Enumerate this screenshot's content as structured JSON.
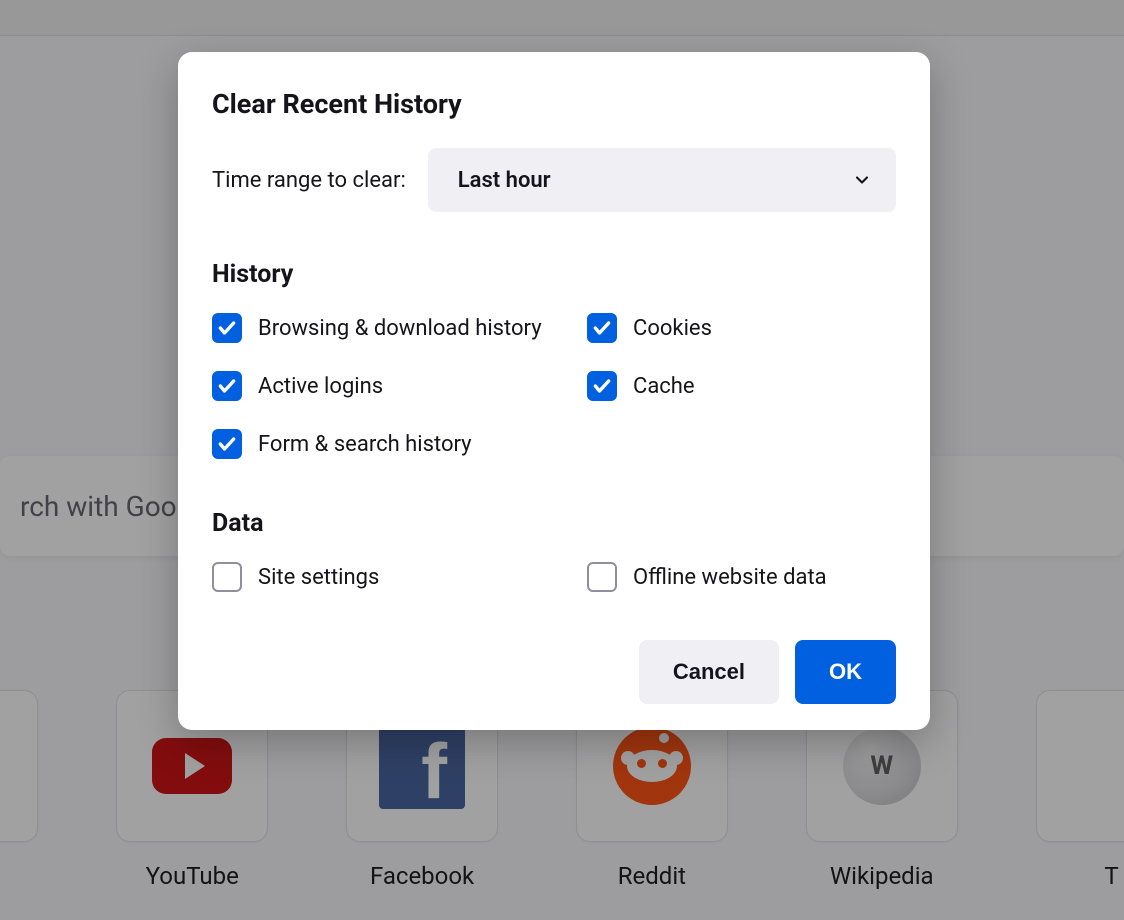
{
  "background": {
    "search_placeholder": "rch with Goog",
    "tiles": [
      {
        "label": "YouTube"
      },
      {
        "label": "Facebook"
      },
      {
        "label": "Reddit"
      },
      {
        "label": "Wikipedia"
      },
      {
        "label": "T"
      }
    ]
  },
  "dialog": {
    "title": "Clear Recent History",
    "time_range_label": "Time range to clear:",
    "time_range_value": "Last hour",
    "sections": {
      "history": {
        "header": "History",
        "options": [
          {
            "label": "Browsing & download history",
            "checked": true
          },
          {
            "label": "Cookies",
            "checked": true
          },
          {
            "label": "Active logins",
            "checked": true
          },
          {
            "label": "Cache",
            "checked": true
          },
          {
            "label": "Form & search history",
            "checked": true
          }
        ]
      },
      "data": {
        "header": "Data",
        "options": [
          {
            "label": "Site settings",
            "checked": false
          },
          {
            "label": "Offline website data",
            "checked": false
          }
        ]
      }
    },
    "buttons": {
      "cancel": "Cancel",
      "ok": "OK"
    }
  }
}
